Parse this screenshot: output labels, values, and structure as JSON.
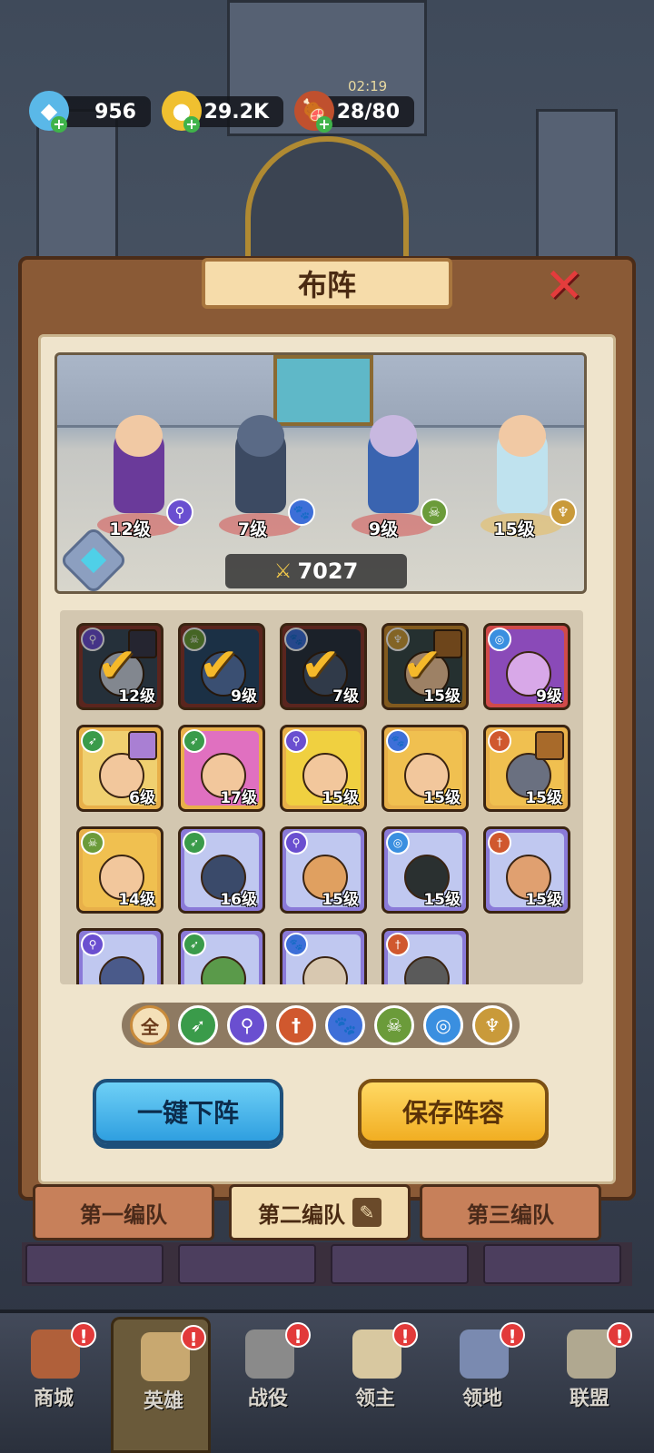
{
  "resources": {
    "gems": "956",
    "gold": "29.2K",
    "stamina": "28/80",
    "timer": "02:19"
  },
  "panel": {
    "title": "布阵",
    "power": "7027"
  },
  "formation": [
    {
      "level": "12级",
      "class": "mage"
    },
    {
      "level": "7级",
      "class": "beast"
    },
    {
      "level": "9级",
      "class": "undead"
    },
    {
      "level": "15级",
      "class": "holy"
    }
  ],
  "heroes": [
    {
      "level": "12级",
      "class": "mage",
      "selected": true
    },
    {
      "level": "9级",
      "class": "undead",
      "selected": true
    },
    {
      "level": "7级",
      "class": "beast",
      "selected": true
    },
    {
      "level": "15级",
      "class": "holy",
      "selected": true
    },
    {
      "level": "9级",
      "class": "spirit",
      "selected": false
    },
    {
      "level": "6级",
      "class": "ranger",
      "selected": false
    },
    {
      "level": "17级",
      "class": "ranger",
      "selected": false
    },
    {
      "level": "15级",
      "class": "mage",
      "selected": false
    },
    {
      "level": "15级",
      "class": "beast",
      "selected": false
    },
    {
      "level": "15级",
      "class": "warrior",
      "selected": false
    },
    {
      "level": "14级",
      "class": "undead",
      "selected": false
    },
    {
      "level": "16级",
      "class": "ranger",
      "selected": false
    },
    {
      "level": "15级",
      "class": "mage",
      "selected": false
    },
    {
      "level": "15级",
      "class": "spirit",
      "selected": false
    },
    {
      "level": "15级",
      "class": "warrior",
      "selected": false
    },
    {
      "level": "",
      "class": "mage",
      "selected": false
    },
    {
      "level": "",
      "class": "ranger",
      "selected": false
    },
    {
      "level": "",
      "class": "beast",
      "selected": false
    },
    {
      "level": "",
      "class": "warrior",
      "selected": false
    }
  ],
  "filters": {
    "all": "全"
  },
  "buttons": {
    "unequip_all": "一键下阵",
    "save_lineup": "保存阵容"
  },
  "teams": {
    "team1": "第一编队",
    "team2": "第二编队",
    "team3": "第三编队"
  },
  "nav": {
    "shop": "商城",
    "heroes": "英雄",
    "campaign": "战役",
    "lord": "领主",
    "territory": "领地",
    "alliance": "联盟",
    "badge": "!"
  },
  "colors": {
    "mage": "#6a4fd0",
    "undead": "#6b9b3a",
    "beast": "#3d6fd8",
    "holy": "#c99a3a",
    "spirit": "#3a8fe0",
    "ranger": "#3a9b4a",
    "warrior": "#d0582e"
  }
}
